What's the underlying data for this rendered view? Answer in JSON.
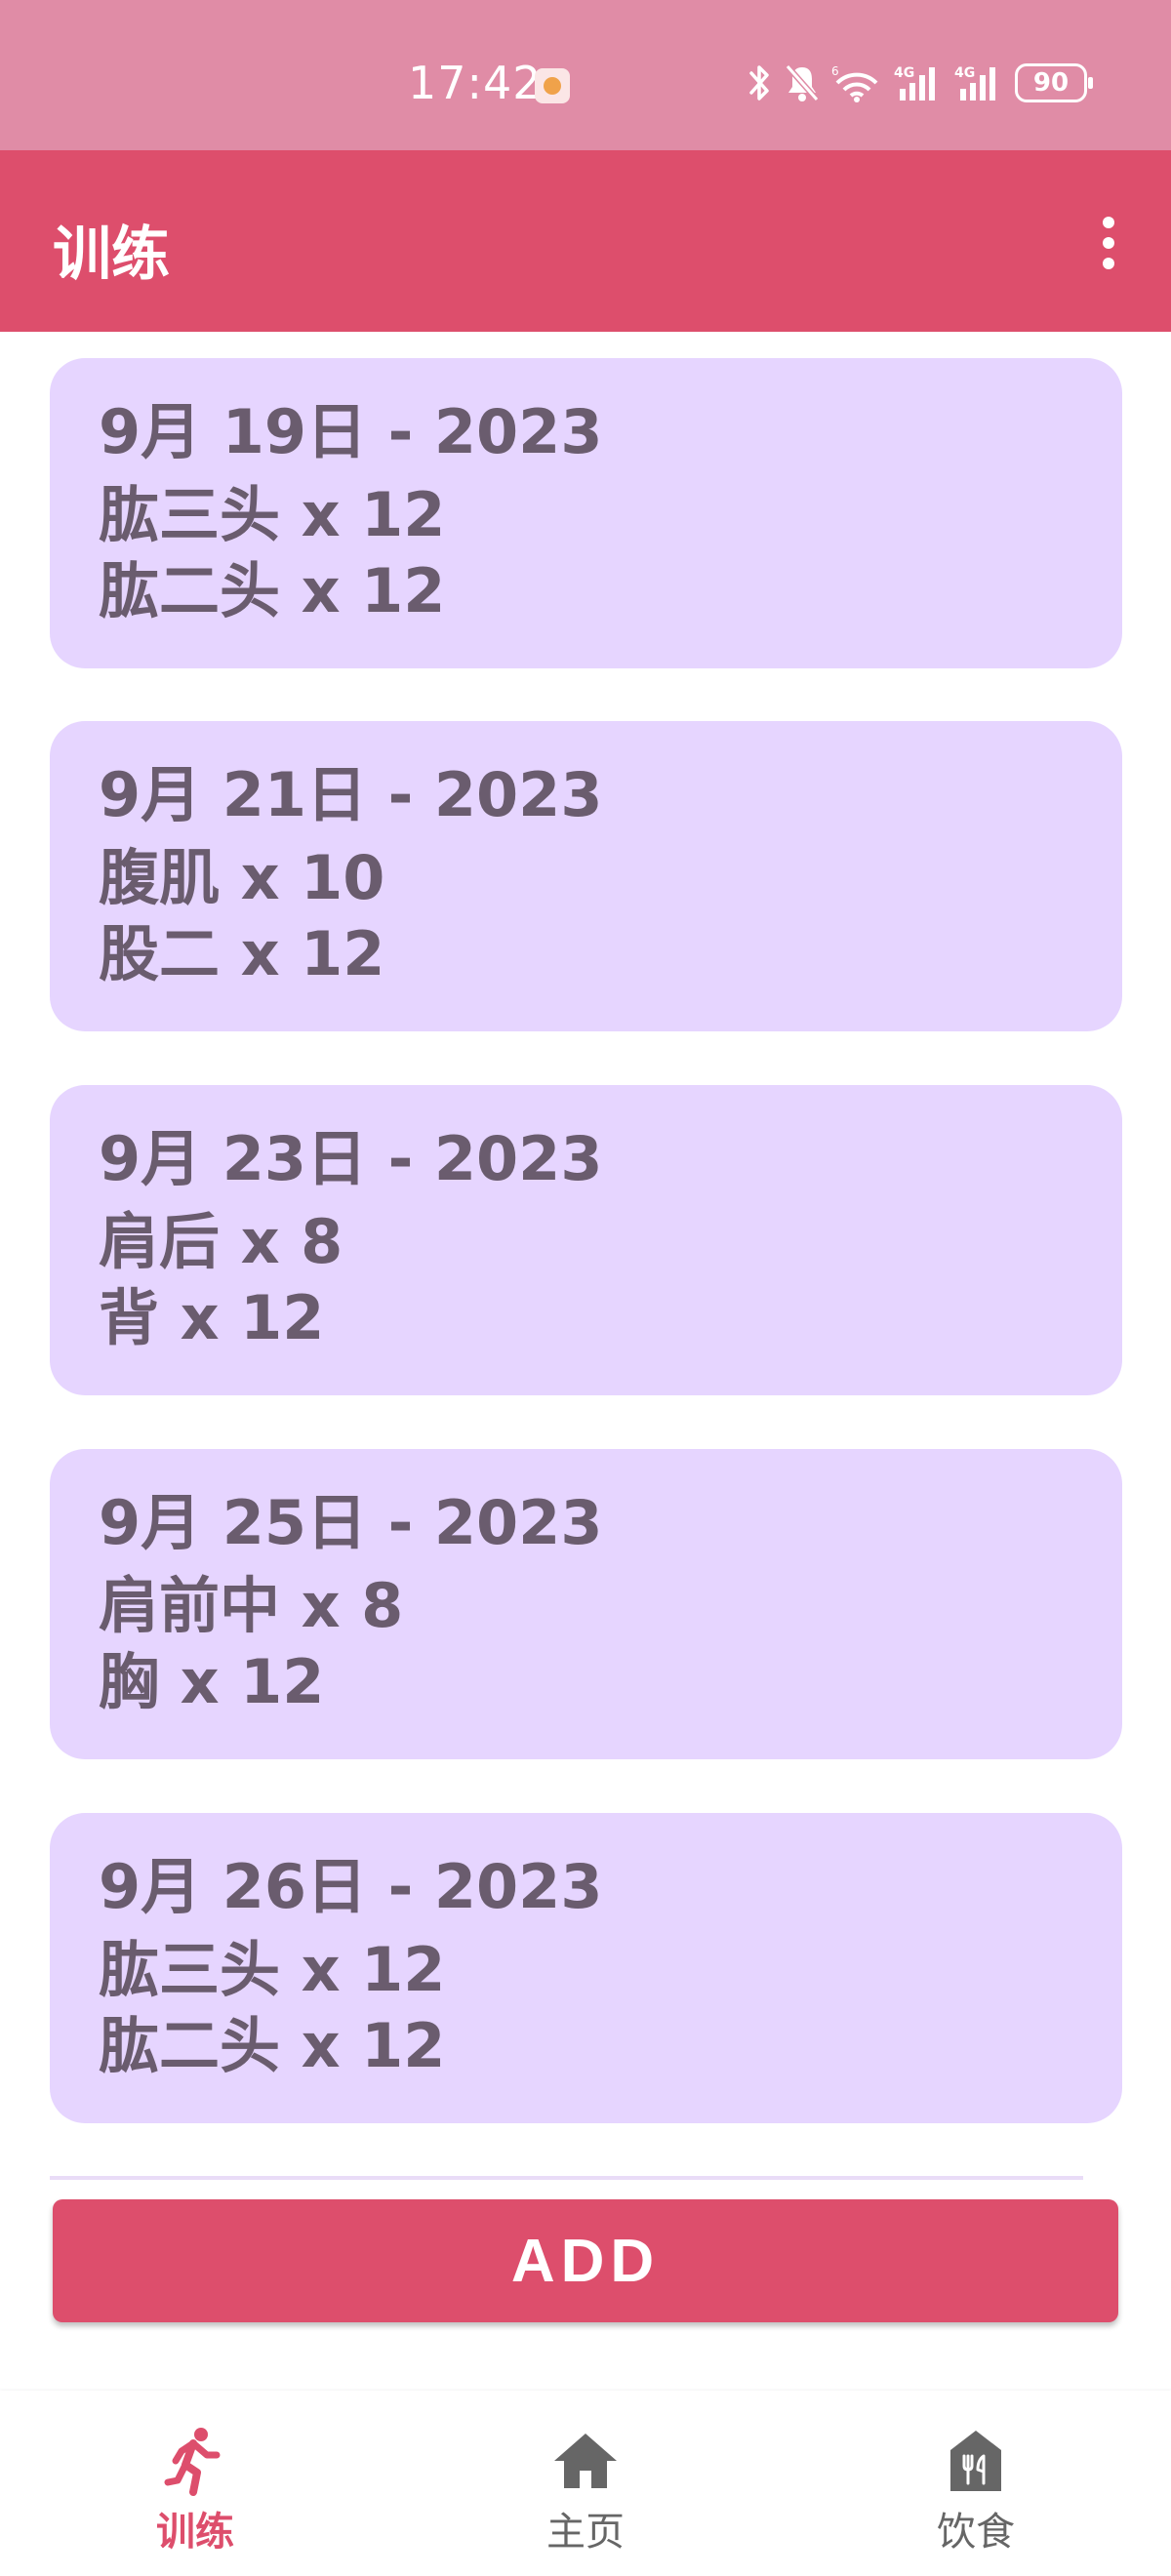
{
  "status_bar": {
    "time": "17:42",
    "battery": "90",
    "icons": [
      "bluetooth-icon",
      "mute-icon",
      "wifi-icon",
      "signal-4g-icon",
      "signal-4g-icon",
      "battery-icon"
    ]
  },
  "app_bar": {
    "title": "训练"
  },
  "workouts": [
    {
      "date": "9月 19日 - 2023",
      "exercises": [
        "肱三头 x 12",
        "肱二头 x 12"
      ]
    },
    {
      "date": "9月 21日 - 2023",
      "exercises": [
        "腹肌 x 10",
        "股二 x 12"
      ]
    },
    {
      "date": "9月 23日 - 2023",
      "exercises": [
        "肩后 x 8",
        "背 x 12"
      ]
    },
    {
      "date": "9月 25日 - 2023",
      "exercises": [
        "肩前中 x 8",
        "胸 x 12"
      ]
    },
    {
      "date": "9月 26日 - 2023",
      "exercises": [
        "肱三头 x 12",
        "肱二头 x 12"
      ]
    }
  ],
  "add_button": {
    "label": "ADD"
  },
  "bottom_nav": {
    "items": [
      {
        "label": "训练",
        "icon": "run-icon",
        "active": true
      },
      {
        "label": "主页",
        "icon": "home-icon",
        "active": false
      },
      {
        "label": "饮食",
        "icon": "restaurant-icon",
        "active": false
      }
    ]
  },
  "colors": {
    "status_bar": "#e08ca6",
    "primary": "#dd4e6c",
    "card_background": "#e6d5ff",
    "card_text": "#6a5c6e",
    "nav_inactive": "#666666"
  }
}
